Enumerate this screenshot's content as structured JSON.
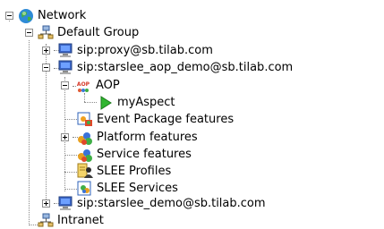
{
  "tree": {
    "network": "Network",
    "default_group": "Default Group",
    "proxy": "sip:proxy@sb.tilab.com",
    "aop_demo": "sip:starslee_aop_demo@sb.tilab.com",
    "aop": "AOP",
    "aop_icon_text": "AOP",
    "my_aspect": "myAspect",
    "event_package": "Event Package features",
    "platform": "Platform features",
    "service": "Service features",
    "slee_profiles": "SLEE Profiles",
    "slee_services": "SLEE Services",
    "demo": "sip:starslee_demo@sb.tilab.com",
    "intranet": "Intranet"
  },
  "icons": {
    "network": "globe-icon",
    "group": "network-group-icon",
    "computer": "computer-icon",
    "aop": "aop-icon",
    "aspect": "play-arrow-icon",
    "event": "event-package-icon",
    "platform": "platform-features-icon",
    "service": "service-features-icon",
    "profiles": "slee-profiles-icon",
    "services": "slee-services-icon"
  },
  "colors": {
    "tree_line": "#8a8a8a",
    "globe": "#2e8bd6",
    "arrow": "#2fb52f"
  }
}
